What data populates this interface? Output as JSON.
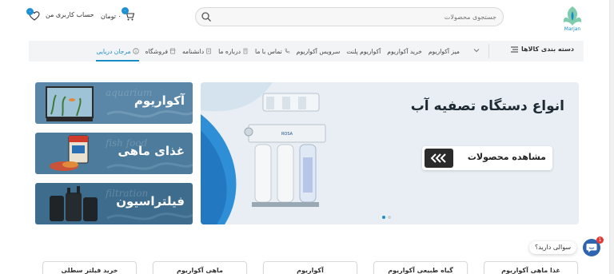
{
  "header": {
    "logo_text": "Marjan",
    "search_placeholder": "جستجوی محصولات",
    "cart_label": "۰ تومان",
    "cart_count": "۰",
    "account_label": "حساب کاربری من",
    "wishlist_count": "۰"
  },
  "nav": {
    "categories_label": "دسته بندی کالاها",
    "items": [
      {
        "label": "مرجان دریایی",
        "icon": "info-icon",
        "active": true
      },
      {
        "label": "فروشگاه",
        "icon": "store-icon"
      },
      {
        "label": "دانشنامه",
        "icon": "book-icon"
      },
      {
        "label": "درباره ما",
        "icon": "building-icon"
      },
      {
        "label": "تماس با ما",
        "icon": "phone-icon"
      },
      {
        "label": "سرویس آکواریوم",
        "icon": ""
      },
      {
        "label": "آکواریوم پلنت",
        "icon": ""
      },
      {
        "label": "خرید آکواریوم",
        "icon": ""
      },
      {
        "label": "میز آکواریوم",
        "icon": ""
      }
    ]
  },
  "hero": {
    "title": "انواع دستگاه تصفیه آب",
    "button_label": "مشاهده محصولات",
    "slides": 2,
    "active_slide": 1
  },
  "side_banners": [
    {
      "label": "آکواریوم",
      "ghost": "aquarium",
      "color": "#5a87a8"
    },
    {
      "label": "غذای ماهی",
      "ghost": "fish food",
      "color": "#4d7b9b"
    },
    {
      "label": "فیلتراسیون",
      "ghost": "filtration",
      "color": "#3e6c8d"
    }
  ],
  "categories": [
    "غذا ماهی آکواریوم",
    "گیاه طبیعی آکواریوم",
    "آکواریوم",
    "ماهی آکواریوم",
    "خرید فیلتر سطلی"
  ],
  "chat": {
    "prompt": "سوالی دارید؟",
    "badge": "1"
  },
  "colors": {
    "accent": "#1a8cc9",
    "hero_bg": "#e8eef3",
    "dark_button": "#2b2b2b"
  }
}
